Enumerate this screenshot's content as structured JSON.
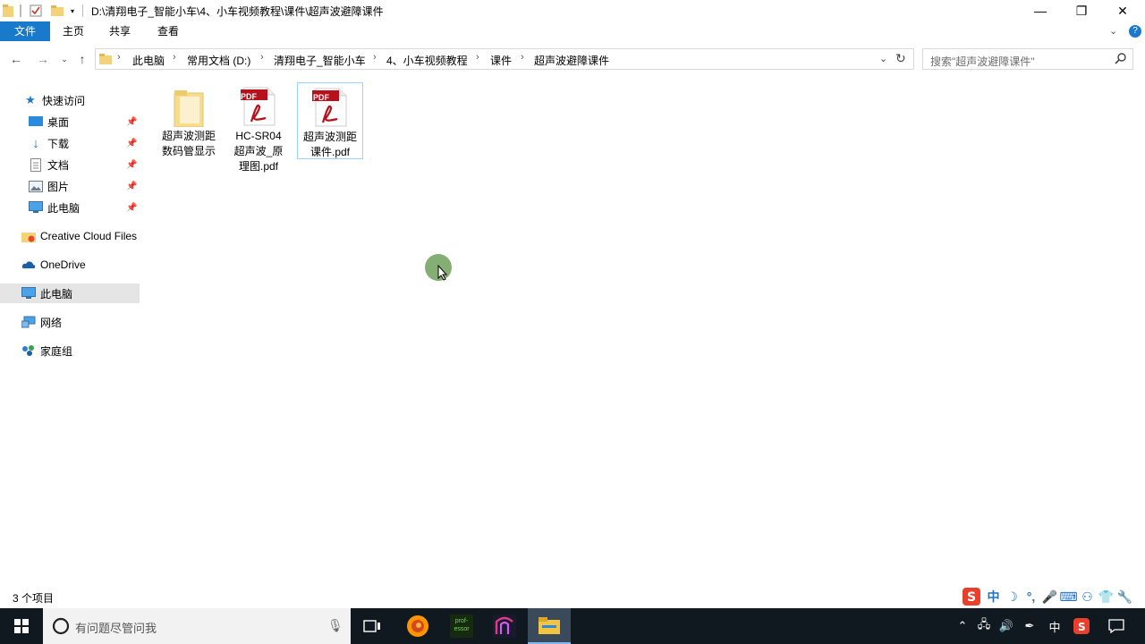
{
  "window": {
    "title": "D:\\清翔电子_智能小车\\4、小车视频教程\\课件\\超声波避障课件",
    "controls": {
      "minimize": "—",
      "restore": "❐",
      "close": "✕"
    }
  },
  "ribbon": {
    "tabs": [
      "文件",
      "主页",
      "共享",
      "查看"
    ]
  },
  "address": {
    "breadcrumbs": [
      "此电脑",
      "常用文档 (D:)",
      "清翔电子_智能小车",
      "4、小车视频教程",
      "课件",
      "超声波避障课件"
    ],
    "search_placeholder": "搜索\"超声波避障课件\""
  },
  "nav": {
    "quick_access": "快速访问",
    "quick_items": [
      "桌面",
      "下载",
      "文档",
      "图片",
      "此电脑"
    ],
    "creative_cloud": "Creative Cloud Files",
    "onedrive": "OneDrive",
    "this_pc": "此电脑",
    "network": "网络",
    "homegroup": "家庭组"
  },
  "files": [
    {
      "name": "超声波测距数码管显示",
      "type": "folder",
      "label_lines": [
        "超声波测距",
        "数码管显示"
      ]
    },
    {
      "name": "HC-SR04超声波_原理图.pdf",
      "type": "pdf",
      "label_lines": [
        "HC-SR04",
        "超声波_原",
        "理图.pdf"
      ]
    },
    {
      "name": "超声波测距课件.pdf",
      "type": "pdf",
      "label_lines": [
        "超声波测距",
        "课件.pdf"
      ],
      "selected": true
    }
  ],
  "pdf_badge": "PDF",
  "status": {
    "item_count": "3 个项目"
  },
  "ime": {
    "mode": "中"
  },
  "taskbar": {
    "search_text": "有问题尽管问我",
    "professor_label": "prof-\nessor",
    "tray_ime": "中"
  },
  "colors": {
    "accent": "#1979ca",
    "pdf_red": "#b5121b",
    "folder_yellow": "#f3d27a"
  }
}
